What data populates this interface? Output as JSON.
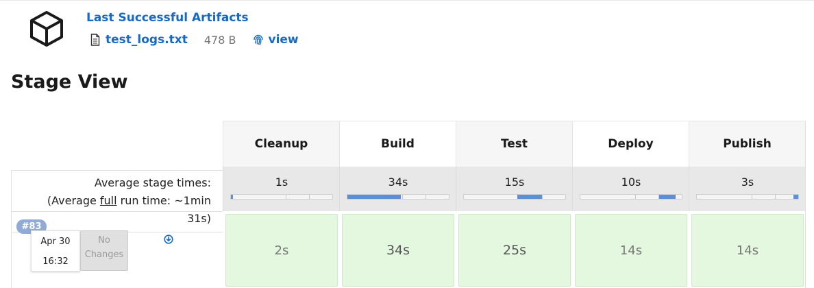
{
  "artifacts": {
    "title": "Last Successful Artifacts",
    "file_name": "test_logs.txt",
    "file_size": "478 B",
    "view_label": "view"
  },
  "stage_view": {
    "title": "Stage View",
    "avg_label_line1": "Average stage times:",
    "avg_label_prefix": "(Average ",
    "avg_label_full": "full",
    "avg_label_suffix": " run time: ~1min",
    "avg_label_line3": "31s)",
    "stages": [
      {
        "name": "Cleanup",
        "avg": "1s",
        "bar_start": 0.0,
        "bar_end": 0.02,
        "cell": "2s"
      },
      {
        "name": "Build",
        "avg": "34s",
        "bar_start": 0.0,
        "bar_end": 0.53,
        "cell": "34s"
      },
      {
        "name": "Test",
        "avg": "15s",
        "bar_start": 0.53,
        "bar_end": 0.77,
        "cell": "25s"
      },
      {
        "name": "Deploy",
        "avg": "10s",
        "bar_start": 0.78,
        "bar_end": 0.94,
        "cell": "14s"
      },
      {
        "name": "Publish",
        "avg": "3s",
        "bar_start": 0.95,
        "bar_end": 1.0,
        "cell": "14s"
      }
    ]
  },
  "build": {
    "number": "#83",
    "date": "Apr 30",
    "time": "16:32",
    "changes_line1": "No",
    "changes_line2": "Changes"
  },
  "colors": {
    "link": "#1769c4",
    "success_cell": "#e3f8de",
    "bar_fill": "#5b8fd6",
    "badge": "#90acd6"
  }
}
